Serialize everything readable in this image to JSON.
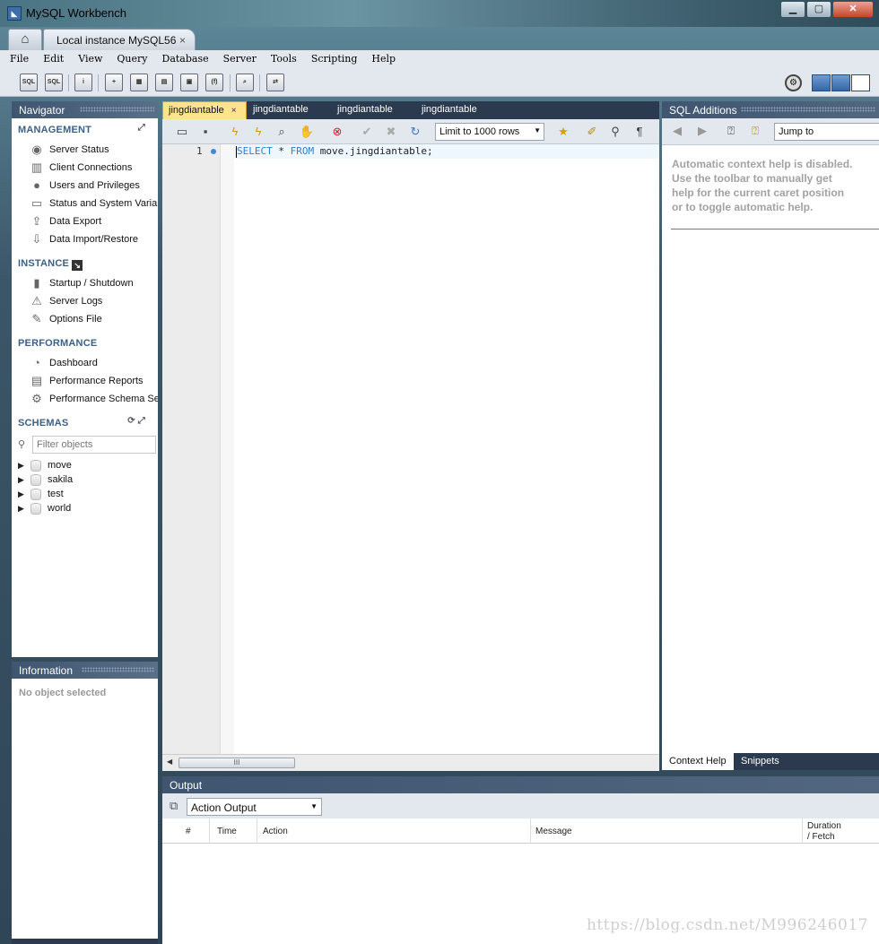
{
  "window": {
    "title": "MySQL Workbench"
  },
  "app_tabs": {
    "home_icon": "home-icon",
    "instance_tab": "Local instance MySQL56",
    "close_glyph": "×"
  },
  "menu": [
    "File",
    "Edit",
    "View",
    "Query",
    "Database",
    "Server",
    "Tools",
    "Scripting",
    "Help"
  ],
  "navigator": {
    "header": "Navigator",
    "management_title": "MANAGEMENT",
    "management": [
      {
        "label": "Server Status",
        "icon": "play-circle-icon"
      },
      {
        "label": "Client Connections",
        "icon": "connections-icon"
      },
      {
        "label": "Users and Privileges",
        "icon": "user-icon"
      },
      {
        "label": "Status and System Variables",
        "icon": "monitor-icon"
      },
      {
        "label": "Data Export",
        "icon": "export-icon"
      },
      {
        "label": "Data Import/Restore",
        "icon": "import-icon"
      }
    ],
    "instance_title": "INSTANCE",
    "instance": [
      {
        "label": "Startup / Shutdown",
        "icon": "power-icon"
      },
      {
        "label": "Server Logs",
        "icon": "warning-icon"
      },
      {
        "label": "Options File",
        "icon": "wrench-icon"
      }
    ],
    "performance_title": "PERFORMANCE",
    "performance": [
      {
        "label": "Dashboard",
        "icon": "dashboard-icon"
      },
      {
        "label": "Performance Reports",
        "icon": "reports-icon"
      },
      {
        "label": "Performance Schema Setup",
        "icon": "setup-icon"
      }
    ],
    "schemas_title": "SCHEMAS",
    "filter_placeholder": "Filter objects",
    "schemas": [
      "move",
      "sakila",
      "test",
      "world"
    ]
  },
  "information": {
    "header": "Information",
    "empty": "No object selected"
  },
  "editor": {
    "tabs": [
      "jingdiantable",
      "jingdiantable",
      "jingdiantable",
      "jingdiantable"
    ],
    "limit": "Limit to 1000 rows",
    "line_number": "1",
    "sql": {
      "kw1": "SELECT",
      "star": " * ",
      "kw2": "FROM",
      "rest": " move.jingdiantable;"
    },
    "scroll_grip": "III"
  },
  "sql_additions": {
    "header": "SQL Additions",
    "jump_to": "Jump to",
    "help_lines": [
      "Automatic context help is disabled.",
      "Use the toolbar to manually get",
      "help for the current caret position",
      "or to toggle automatic help."
    ],
    "tabs": [
      "Context Help",
      "Snippets"
    ]
  },
  "output": {
    "header": "Output",
    "selector": "Action Output",
    "columns": [
      "#",
      "Time",
      "Action",
      "Message",
      "Duration",
      "/ Fetch"
    ]
  },
  "watermark": "https://blog.csdn.net/M996246017",
  "colors": {
    "accent": "#3c5f87",
    "keyword": "#2f7fd0",
    "active_tab": "#fde48a"
  }
}
